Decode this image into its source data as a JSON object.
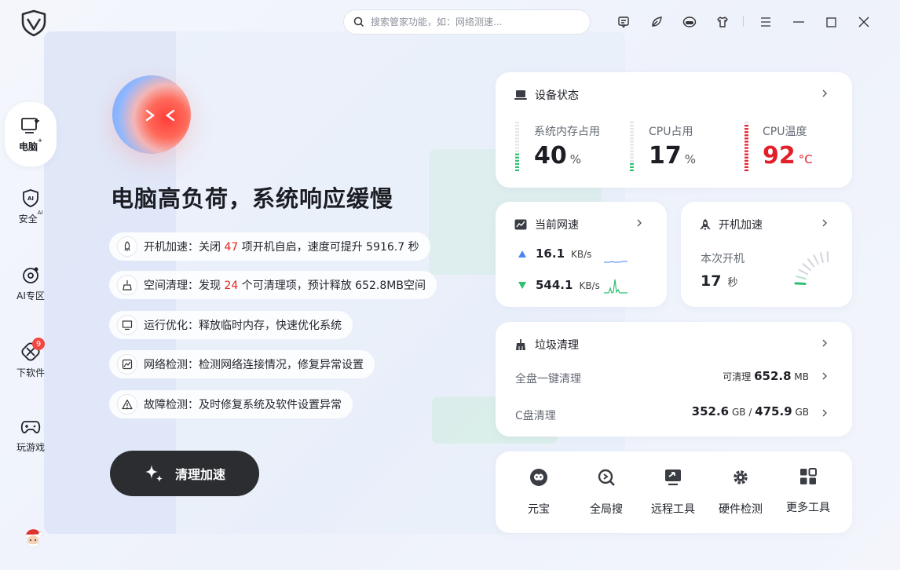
{
  "search": {
    "placeholder": "搜索管家功能，如：网络测速..."
  },
  "nav": [
    {
      "label": "电脑",
      "sup": "+"
    },
    {
      "label": "安全",
      "sup": "AI"
    },
    {
      "label": "AI专区"
    },
    {
      "label": "下软件",
      "badge": "9"
    },
    {
      "label": "玩游戏"
    }
  ],
  "hero": {
    "headline": "电脑高负荷，系统响应缓慢",
    "issues": [
      {
        "pre": "开机加速：关闭 ",
        "num": "47",
        "post": " 项开机自启，速度可提升 5916.7 秒"
      },
      {
        "pre": "空间清理：发现 ",
        "num": "24",
        "post": " 个可清理项，预计释放 652.8MB空间"
      },
      {
        "pre": "运行优化：释放临时内存，快速优化系统",
        "num": "",
        "post": ""
      },
      {
        "pre": "网络检测：检测网络连接情况，修复异常设置",
        "num": "",
        "post": ""
      },
      {
        "pre": "故障检测：及时修复系统及软件设置异常",
        "num": "",
        "post": ""
      }
    ],
    "button": "清理加速"
  },
  "device": {
    "title": "设备状态",
    "memory": {
      "name": "系统内存占用",
      "value": "40",
      "unit": "%",
      "level": 0.4
    },
    "cpu": {
      "name": "CPU占用",
      "value": "17",
      "unit": "%",
      "level": 0.17
    },
    "temp": {
      "name": "CPU温度",
      "value": "92",
      "unit": "°C",
      "level": 0.92
    }
  },
  "network": {
    "title": "当前网速",
    "up": {
      "value": "16.1",
      "unit": "KB/s"
    },
    "down": {
      "value": "544.1",
      "unit": "KB/s"
    }
  },
  "boot": {
    "title": "开机加速",
    "label": "本次开机",
    "value": "17",
    "unit": "秒"
  },
  "junk": {
    "title": "垃圾清理",
    "full": {
      "label": "全盘一键清理",
      "prefix": "可清理",
      "value": "652.8",
      "unit": "MB"
    },
    "cdrive": {
      "label": "C盘清理",
      "used": "352.6",
      "used_unit": "GB",
      "sep": "/",
      "total": "475.9",
      "total_unit": "GB"
    }
  },
  "tools": [
    "元宝",
    "全局搜",
    "远程工具",
    "硬件检测",
    "更多工具"
  ],
  "colors": {
    "accent_green": "#2fbf71",
    "hot_red": "#e2202a",
    "button_dark": "#2b2d31"
  }
}
